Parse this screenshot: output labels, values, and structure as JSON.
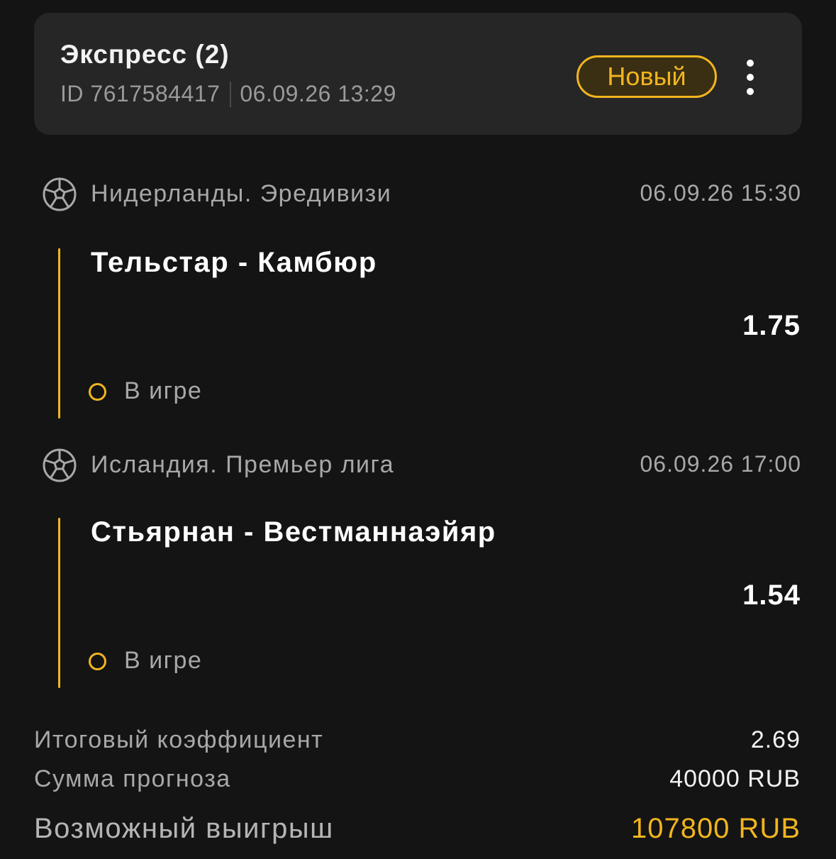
{
  "header": {
    "title": "Экспресс (2)",
    "id_text": "ID 7617584417",
    "datetime": "06.09.26 13:29",
    "status_badge": "Новый",
    "more_icon": "more-vertical-icon"
  },
  "events": [
    {
      "sport_icon": "soccer-ball-icon",
      "league": "Нидерланды. Эредивизи",
      "start_time": "06.09.26 15:30",
      "match": "Тельстар - Камбюр",
      "odds": "1.75",
      "status": "В игре"
    },
    {
      "sport_icon": "soccer-ball-icon",
      "league": "Исландия. Премьер лига",
      "start_time": "06.09.26 17:00",
      "match": "Стьярнан - Вестманнаэйяр",
      "odds": "1.54",
      "status": "В игре"
    }
  ],
  "summary": {
    "total_odds_label": "Итоговый коэффициент",
    "total_odds_value": "2.69",
    "stake_label": "Сумма прогноза",
    "stake_value": "40000 RUB",
    "payout_label": "Возможный выигрыш",
    "payout_value": "107800 RUB"
  },
  "colors": {
    "background": "#141414",
    "card": "#262626",
    "accent": "#f2b51f",
    "muted_text": "#a8a8a8"
  }
}
